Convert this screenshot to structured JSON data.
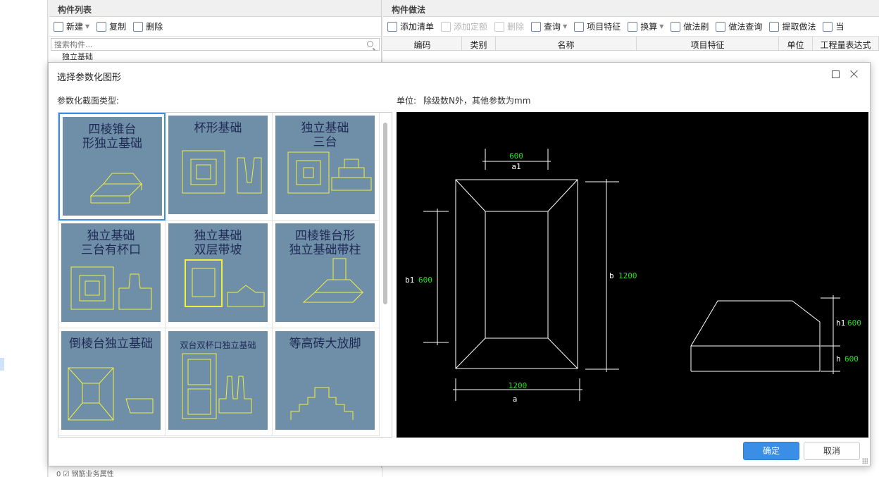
{
  "left_panel": {
    "title": "构件列表",
    "toolbar": [
      {
        "label": "新建",
        "icon": "new-doc-icon",
        "caret": true
      },
      {
        "label": "复制",
        "icon": "copy-icon"
      },
      {
        "label": "删除",
        "icon": "delete-icon"
      }
    ],
    "search_placeholder": "搜索构件...",
    "tree_first_item": "独立基础",
    "bottom_row": "0 ☑ 钢筋业务属性"
  },
  "right_panel": {
    "title": "构件做法",
    "toolbar": [
      {
        "label": "添加清单",
        "icon": "add-list-icon",
        "disabled": false
      },
      {
        "label": "添加定额",
        "icon": "add-quota-icon",
        "disabled": true
      },
      {
        "label": "删除",
        "icon": "delete-icon",
        "disabled": true
      },
      {
        "label": "查询",
        "icon": "query-icon",
        "caret": true
      },
      {
        "label": "项目特征",
        "icon": "feature-icon"
      },
      {
        "label": "换算",
        "icon": "fx-icon",
        "caret": true
      },
      {
        "label": "做法刷",
        "icon": "brush-icon"
      },
      {
        "label": "做法查询",
        "icon": "method-query-icon"
      },
      {
        "label": "提取做法",
        "icon": "extract-icon"
      },
      {
        "label": "当",
        "icon": "current-icon"
      }
    ],
    "columns": [
      "编码",
      "类别",
      "名称",
      "项目特征",
      "单位",
      "工程量表达式"
    ]
  },
  "dialog": {
    "title": "选择参数化图形",
    "section_label": "参数化截面类型:",
    "unit_label": "单位:",
    "unit_text": "除级数N外，其他参数为mm",
    "ok_label": "确定",
    "cancel_label": "取消",
    "selected_index": 0,
    "shapes": [
      {
        "title": "四棱锥台\n形独立基础"
      },
      {
        "title": "杯形基础"
      },
      {
        "title": "独立基础\n三台"
      },
      {
        "title": "独立基础\n三台有杯口"
      },
      {
        "title": "独立基础\n双层带坡"
      },
      {
        "title": "四棱锥台形\n独立基础带柱"
      },
      {
        "title": "倒棱台独立基础"
      },
      {
        "title": "双台双杯口独立基础"
      },
      {
        "title": "等高砖大放脚"
      }
    ],
    "preview": {
      "a1": {
        "value": "600",
        "name": "a1"
      },
      "b1": {
        "value": "600",
        "name": "b1"
      },
      "b": {
        "value": "1200",
        "name": "b"
      },
      "a": {
        "value": "1200",
        "name": "a"
      },
      "h1": {
        "value": "600",
        "name": "h1"
      },
      "h": {
        "value": "600",
        "name": "h"
      }
    },
    "colors": {
      "accent": "#3a8ee6",
      "value_green": "#22dd22",
      "thumb_bg": "#6f8ea7",
      "thumb_line": "#f0f040"
    }
  }
}
